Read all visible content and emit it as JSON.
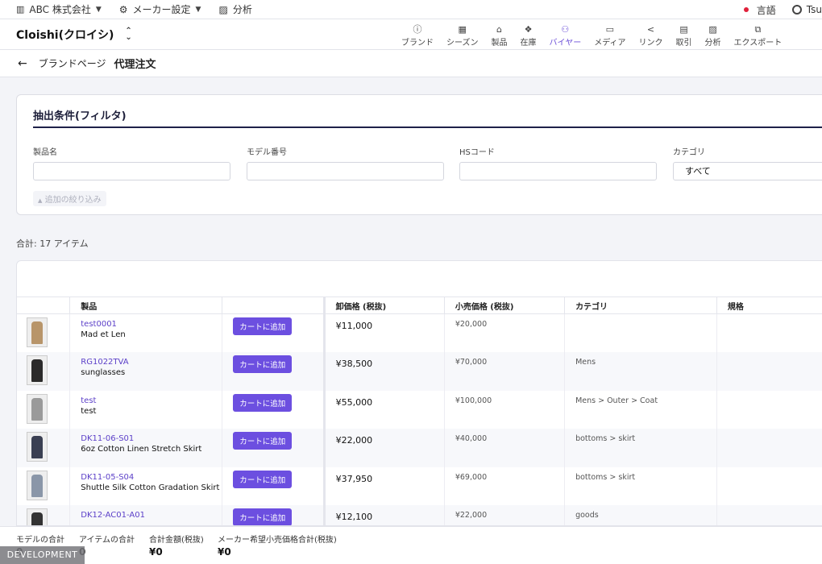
{
  "topbar": {
    "company": "ABC 株式会社",
    "settings": "メーカー設定",
    "analytics": "分析",
    "language": "言語",
    "user": "Tsu"
  },
  "header": {
    "brand": "Cloishi(クロイシ)",
    "nav": [
      {
        "label": "ブランド",
        "icon": "info-icon",
        "glyph": "ⓘ"
      },
      {
        "label": "シーズン",
        "icon": "grid-icon",
        "glyph": "▦"
      },
      {
        "label": "製品",
        "icon": "hanger-icon",
        "glyph": "⌂"
      },
      {
        "label": "在庫",
        "icon": "boxes-icon",
        "glyph": "❖"
      },
      {
        "label": "バイヤー",
        "icon": "people-icon",
        "glyph": "⚇"
      },
      {
        "label": "メディア",
        "icon": "cast-icon",
        "glyph": "▭"
      },
      {
        "label": "リンク",
        "icon": "share-icon",
        "glyph": "<"
      },
      {
        "label": "取引",
        "icon": "receipt-icon",
        "glyph": "▤"
      },
      {
        "label": "分析",
        "icon": "chart-icon",
        "glyph": "▨"
      },
      {
        "label": "エクスポート",
        "icon": "export-icon",
        "glyph": "⧉"
      }
    ],
    "active_nav": "バイヤー"
  },
  "breadcrumb": {
    "parent": "ブランドページ",
    "current": "代理注文"
  },
  "filter": {
    "title": "抽出条件(フィルタ)",
    "fields": [
      {
        "label": "製品名",
        "value": ""
      },
      {
        "label": "モデル番号",
        "value": ""
      },
      {
        "label": "HSコード",
        "value": ""
      },
      {
        "label": "カテゴリ",
        "value": "すべて"
      }
    ],
    "more_filters": "追加の絞り込み"
  },
  "summary": {
    "total": "合計: 17 アイテム"
  },
  "table": {
    "columns": [
      "",
      "製品",
      "",
      "卸価格 (税抜)",
      "小売価格 (税抜)",
      "カテゴリ",
      "規格"
    ],
    "cart_label": "カートに追加",
    "rows": [
      {
        "code": "test0001",
        "name": "Mad et Len",
        "wholesale": "¥11,000",
        "retail": "¥20,000",
        "category": "",
        "thumb_color": "#b8956a"
      },
      {
        "code": "RG1022TVA",
        "name": "sunglasses",
        "wholesale": "¥38,500",
        "retail": "¥70,000",
        "category": "Mens",
        "thumb_color": "#2b2a2a"
      },
      {
        "code": "test",
        "name": "test",
        "wholesale": "¥55,000",
        "retail": "¥100,000",
        "category": "Mens > Outer > Coat",
        "thumb_color": "#9a9a9a"
      },
      {
        "code": "DK11-06-S01",
        "name": "6oz Cotton Linen Stretch Skirt",
        "wholesale": "¥22,000",
        "retail": "¥40,000",
        "category": "bottoms > skirt",
        "thumb_color": "#3a3f52"
      },
      {
        "code": "DK11-05-S04",
        "name": "Shuttle Silk Cotton Gradation Skirt",
        "wholesale": "¥37,950",
        "retail": "¥69,000",
        "category": "bottoms > skirt",
        "thumb_color": "#8a96a8"
      },
      {
        "code": "DK12-AC01-A01",
        "name": "",
        "wholesale": "¥12,100",
        "retail": "¥22,000",
        "category": "goods",
        "thumb_color": "#333333"
      }
    ]
  },
  "footer": {
    "items": [
      {
        "label": "モデルの合計",
        "value": "0"
      },
      {
        "label": "アイテムの合計",
        "value": "0"
      },
      {
        "label": "合計金額(税抜)",
        "value": "¥0"
      },
      {
        "label": "メーカー希望小売価格合計(税抜)",
        "value": "¥0"
      }
    ],
    "env_badge": "DEVELOPMENT"
  }
}
